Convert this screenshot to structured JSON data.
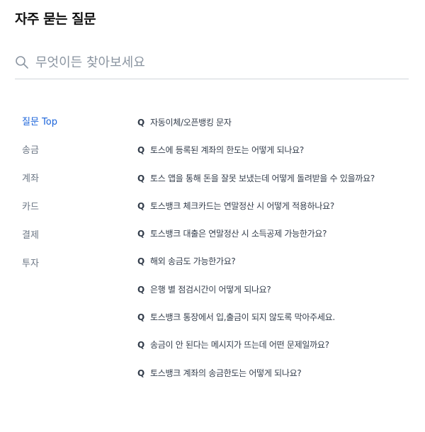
{
  "page": {
    "title": "자주 묻는 질문"
  },
  "search": {
    "icon": "search-icon",
    "placeholder": "무엇이든 찾아보세요",
    "value": ""
  },
  "colors": {
    "accent": "#1b64da",
    "text": "#333d4b",
    "muted": "#6b7684",
    "placeholder": "#8b95a1",
    "divider": "#d1d6db"
  },
  "sidebar": {
    "active_index": 0,
    "items": [
      {
        "label": "질문 Top"
      },
      {
        "label": "송금"
      },
      {
        "label": "계좌"
      },
      {
        "label": "카드"
      },
      {
        "label": "결제"
      },
      {
        "label": "투자"
      }
    ]
  },
  "faq": {
    "marker": "Q",
    "items": [
      {
        "question": "자동이체/오픈뱅킹 문자"
      },
      {
        "question": "토스에 등록된 계좌의 한도는 어떻게 되나요?"
      },
      {
        "question": "토스 앱을 통해 돈을 잘못 보냈는데 어떻게 돌려받을 수 있을까요?"
      },
      {
        "question": "토스뱅크 체크카드는 연말정산 시 어떻게 적용하나요?"
      },
      {
        "question": "토스뱅크 대출은 연말정산 시 소득공제 가능한가요?"
      },
      {
        "question": "해외 송금도 가능한가요?"
      },
      {
        "question": "은행 별 점검시간이 어떻게 되나요?"
      },
      {
        "question": "토스뱅크 통장에서 입,출금이 되지 않도록 막아주세요."
      },
      {
        "question": "송금이 안 된다는 메시지가 뜨는데 어떤 문제일까요?"
      },
      {
        "question": "토스뱅크 계좌의 송금한도는 어떻게 되나요?"
      }
    ]
  }
}
